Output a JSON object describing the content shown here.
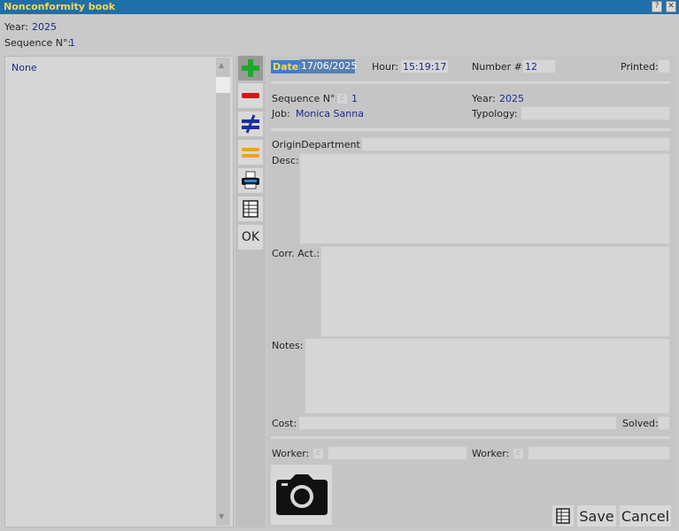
{
  "window": {
    "title": "Nonconformity book",
    "help_label": "?",
    "close_label": "✕"
  },
  "header": {
    "year_label": "Year:",
    "year_value": "2025",
    "sequence_label": "Sequence N°:",
    "sequence_value": "1"
  },
  "list": {
    "items": [
      "None"
    ]
  },
  "toolbar": {
    "ok_label": "OK"
  },
  "form": {
    "date_label": "Date:",
    "date_value": "17/06/2025",
    "hour_label": "Hour:",
    "hour_value": "15:19:17",
    "number_label": "Number #:",
    "number_value": "12",
    "printed_label": "Printed:",
    "sequence_label": "Sequence N°:",
    "sequence_value": "1",
    "year_label": "Year:",
    "year_value": "2025",
    "job_label": "Job:",
    "job_value": "Monica Sanna",
    "typology_label": "Typology:",
    "origin_label": "OriginDepartment:",
    "desc_label": "Desc:",
    "corr_label": "Corr. Act.:",
    "notes_label": "Notes:",
    "cost_label": "Cost:",
    "solved_label": "Solved:",
    "worker1_label": "Worker:",
    "worker2_label": "Worker:",
    "c_glyph": "C"
  },
  "footer": {
    "save_label": "Save",
    "cancel_label": "Cancel"
  },
  "colors": {
    "titlebar": "#1f6fa8",
    "title_text": "#ffd84a",
    "value_text": "#1a2a8a",
    "date_highlight": "#3a7fd0"
  }
}
